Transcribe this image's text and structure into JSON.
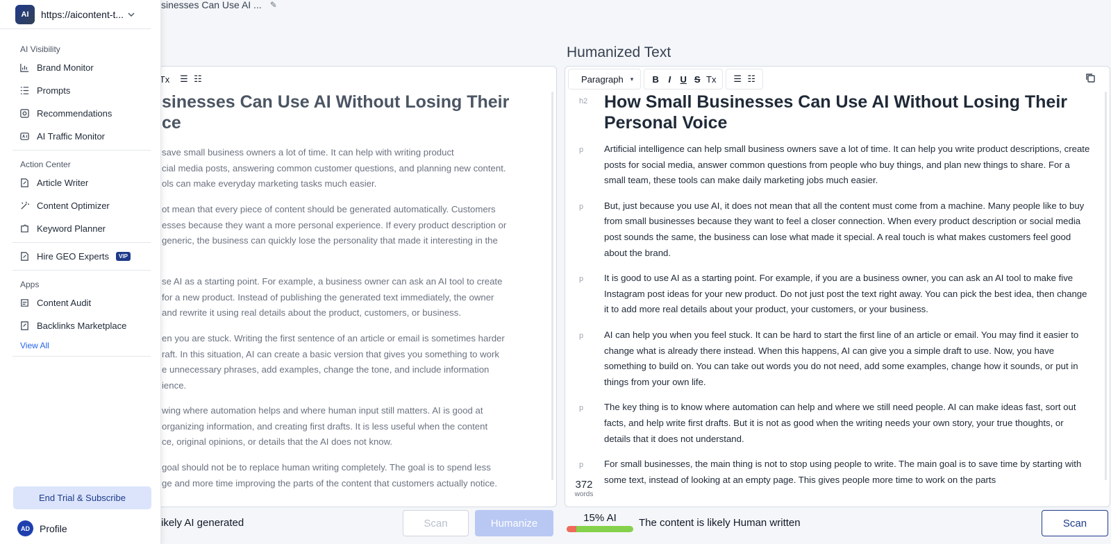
{
  "sidebar": {
    "site_url": "https://aicontent-t...",
    "logo_text": "AI",
    "groups": [
      {
        "title": "AI Visibility",
        "items": [
          {
            "label": "Brand Monitor",
            "icon": "bar-chart-icon"
          },
          {
            "label": "Prompts",
            "icon": "list-icon"
          },
          {
            "label": "Recommendations",
            "icon": "target-icon"
          },
          {
            "label": "AI Traffic Monitor",
            "icon": "ai-chip-icon"
          }
        ]
      },
      {
        "title": "Action Center",
        "items": [
          {
            "label": "Article Writer",
            "icon": "edit-doc-icon"
          },
          {
            "label": "Content Optimizer",
            "icon": "magic-wand-icon"
          },
          {
            "label": "Keyword Planner",
            "icon": "puzzle-icon"
          }
        ]
      },
      {
        "title": "",
        "items": [
          {
            "label": "Hire GEO Experts",
            "icon": "edit-doc-icon",
            "badge": "VIP"
          }
        ]
      },
      {
        "title": "Apps",
        "items": [
          {
            "label": "Content Audit",
            "icon": "audit-icon"
          },
          {
            "label": "Backlinks Marketplace",
            "icon": "link-doc-icon"
          }
        ]
      }
    ],
    "view_all": "View All",
    "subscribe_label": "End Trial & Subscribe",
    "profile_initials": "AD",
    "profile_label": "Profile"
  },
  "doc_title": "sinesses Can Use AI ...",
  "left_panel": {
    "heading": "sinesses Can Use AI Without Losing Their\nce",
    "paragraphs": [
      "save small business owners a lot of time. It can help with writing product\ncial media posts, answering common customer questions, and planning new content.\nols can make everyday marketing tasks much easier.",
      "ot mean that every piece of content should be generated automatically. Customers\nesses because they want a more personal experience. If every product description or\n generic, the business can quickly lose the personality that made it interesting in the",
      "se AI as a starting point. For example, a business owner can ask an AI tool to create\nfor a new product. Instead of publishing the generated text immediately, the owner\nand rewrite it using real details about the product, customers, or business.",
      "en you are stuck. Writing the first sentence of an article or email is sometimes harder\nraft. In this situation, AI can create a basic version that gives you something to work\ne unnecessary phrases, add examples, change the tone, and include information\nience.",
      "wing where automation helps and where human input still matters. AI is good at\norganizing information, and creating first drafts. It is less useful when the content\nce, original opinions, or details that the AI does not know.",
      "goal should not be to replace human writing completely. The goal is to spend less\nge and more time improving the parts of the content that customers actually notice."
    ],
    "status": "ikely AI generated",
    "scan_label": "Scan",
    "humanize_label": "Humanize"
  },
  "right_panel": {
    "title": "Humanized Text",
    "paragraph_select": "Paragraph",
    "heading_tag": "h2",
    "heading": "How Small Businesses Can Use AI Without Losing Their Personal Voice",
    "paragraph_tag": "p",
    "paragraphs": [
      "Artificial intelligence can help small business owners save a lot of time. It can help you write product descriptions, create posts for social media, answer common questions from people who buy things, and plan new things to share. For a small team, these tools can make daily marketing jobs much easier.",
      "But, just because you use AI, it does not mean that all the content must come from a machine. Many people like to buy from small businesses because they want to feel a closer connection. When every product description or social media post sounds the same, the business can lose what made it special. A real touch is what makes customers feel good about the brand.",
      "It is good to use AI as a starting point. For example, if you are a business owner, you can ask an AI tool to make five Instagram post ideas for your new product. Do not just post the text right away. You can pick the best idea, then change it to add more real details about your product, your customers, or your business.",
      "AI can help you when you feel stuck. It can be hard to start the first line of an article or email. You may find it easier to change what is already there instead. When this happens, AI can give you a simple draft to use. Now, you have something to build on. You can take out words you do not need, add some examples, change how it sounds, or put in things from your own life.",
      "The key thing is to know where automation can help and where we still need people. AI can make ideas fast, sort out facts, and help write first drafts. But it is not as good when the writing needs your own story, your true thoughts, or details that it does not understand.",
      "For small businesses, the main thing is not to stop using people to write. The main goal is to save time by starting with some text, instead of looking at an empty page. This gives people more time to work on the parts"
    ],
    "word_count": "372",
    "word_count_unit": "words",
    "ai_score_label": "15% AI",
    "ai_fraction": 0.15,
    "status": "The content is likely Human written",
    "scan_label": "Scan"
  },
  "colors": {
    "accent": "#1e3a8a",
    "human_green": "#86d14b",
    "ai_red": "#ef6b5b"
  }
}
